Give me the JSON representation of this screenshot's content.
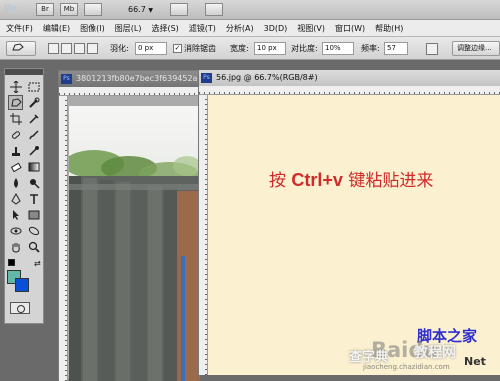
{
  "appbar": {
    "logo": "Ps",
    "br_label": "Br",
    "mb_label": "Mb",
    "zoom": "66.7",
    "zoom_arrow": "▼"
  },
  "menu": [
    "文件(F)",
    "编辑(E)",
    "图像(I)",
    "图层(L)",
    "选择(S)",
    "滤镜(T)",
    "分析(A)",
    "3D(D)",
    "视图(V)",
    "窗口(W)",
    "帮助(H)"
  ],
  "options": {
    "feather_label": "羽化:",
    "feather_value": "0 px",
    "antialias_label": "消除锯齿",
    "antialias_checked": true,
    "width_label": "宽度:",
    "width_value": "10 px",
    "contrast_label": "对比度:",
    "contrast_value": "10%",
    "frequency_label": "频率:",
    "frequency_value": "57",
    "refine_label": "调整边缘..."
  },
  "colors": {
    "foreground": "#63b7a6",
    "background": "#0a4fd8"
  },
  "doc1": {
    "tab_title": "3801213fb80e7bec3f639452a"
  },
  "doc2": {
    "tab_title": "56.jpg @ 66.7%(RGB/8#)",
    "text_prefix": "按 ",
    "text_key": "Ctrl+v",
    "text_suffix": " 键粘贴进来"
  },
  "watermark": {
    "site_name": "脚本之家",
    "brand": "Baidu",
    "sub": "教程网",
    "prefix": "查字典",
    "url": "jiaocheng.chazidian.com",
    "net": "Net"
  }
}
